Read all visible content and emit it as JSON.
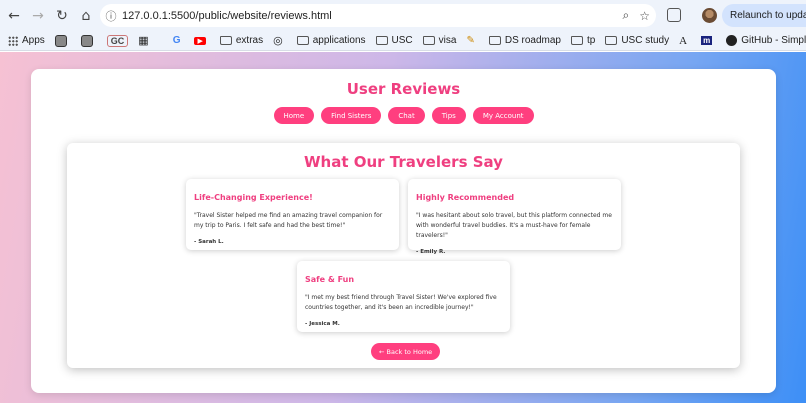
{
  "browser": {
    "url": "127.0.0.1:5500/public/website/reviews.html",
    "relaunch_label": "Relaunch to update",
    "bookmarks": [
      {
        "label": "Apps",
        "icon": "apps-grid-icon"
      },
      {
        "label": "",
        "icon": "square-app-icon"
      },
      {
        "label": "",
        "icon": "square-app-icon"
      },
      {
        "label": "GC",
        "icon": "gc-badge-icon"
      },
      {
        "label": "",
        "icon": "qr-icon"
      },
      {
        "label": "",
        "icon": "google-icon"
      },
      {
        "label": "",
        "icon": "youtube-icon"
      },
      {
        "label": "extras",
        "icon": "folder-icon"
      },
      {
        "label": "",
        "icon": "openai-icon"
      },
      {
        "label": "applications",
        "icon": "folder-icon"
      },
      {
        "label": "USC",
        "icon": "folder-icon"
      },
      {
        "label": "visa",
        "icon": "folder-icon"
      },
      {
        "label": "",
        "icon": "pen-icon"
      },
      {
        "label": "DS roadmap",
        "icon": "folder-icon"
      },
      {
        "label": "tp",
        "icon": "folder-icon"
      },
      {
        "label": "USC study",
        "icon": "folder-icon"
      },
      {
        "label": "",
        "icon": "font-a-icon"
      },
      {
        "label": "",
        "icon": "m-icon"
      },
      {
        "label": "GitHub - Simplify/o...",
        "icon": "github-icon"
      }
    ]
  },
  "site": {
    "title": "User Reviews",
    "nav": [
      "Home",
      "Find Sisters",
      "Chat",
      "Tips",
      "My Account"
    ]
  },
  "section": {
    "title": "What Our Travelers Say",
    "back_label": "← Back to Home"
  },
  "reviews": [
    {
      "title": "Life-Changing Experience!",
      "quote": "\"Travel Sister helped me find an amazing travel companion for my trip to Paris. I felt safe and had the best time!\"",
      "author": "- Sarah L."
    },
    {
      "title": "Highly Recommended",
      "quote": "\"I was hesitant about solo travel, but this platform connected me with wonderful travel buddies. It's a must-have for female travelers!\"",
      "author": "- Emily R."
    },
    {
      "title": "Safe & Fun",
      "quote": "\"I met my best friend through Travel Sister! We've explored five countries together, and it's been an incredible journey!\"",
      "author": "- Jessica M."
    }
  ],
  "colors": {
    "accent": "#ff3f7f",
    "title": "#ef3f80"
  }
}
